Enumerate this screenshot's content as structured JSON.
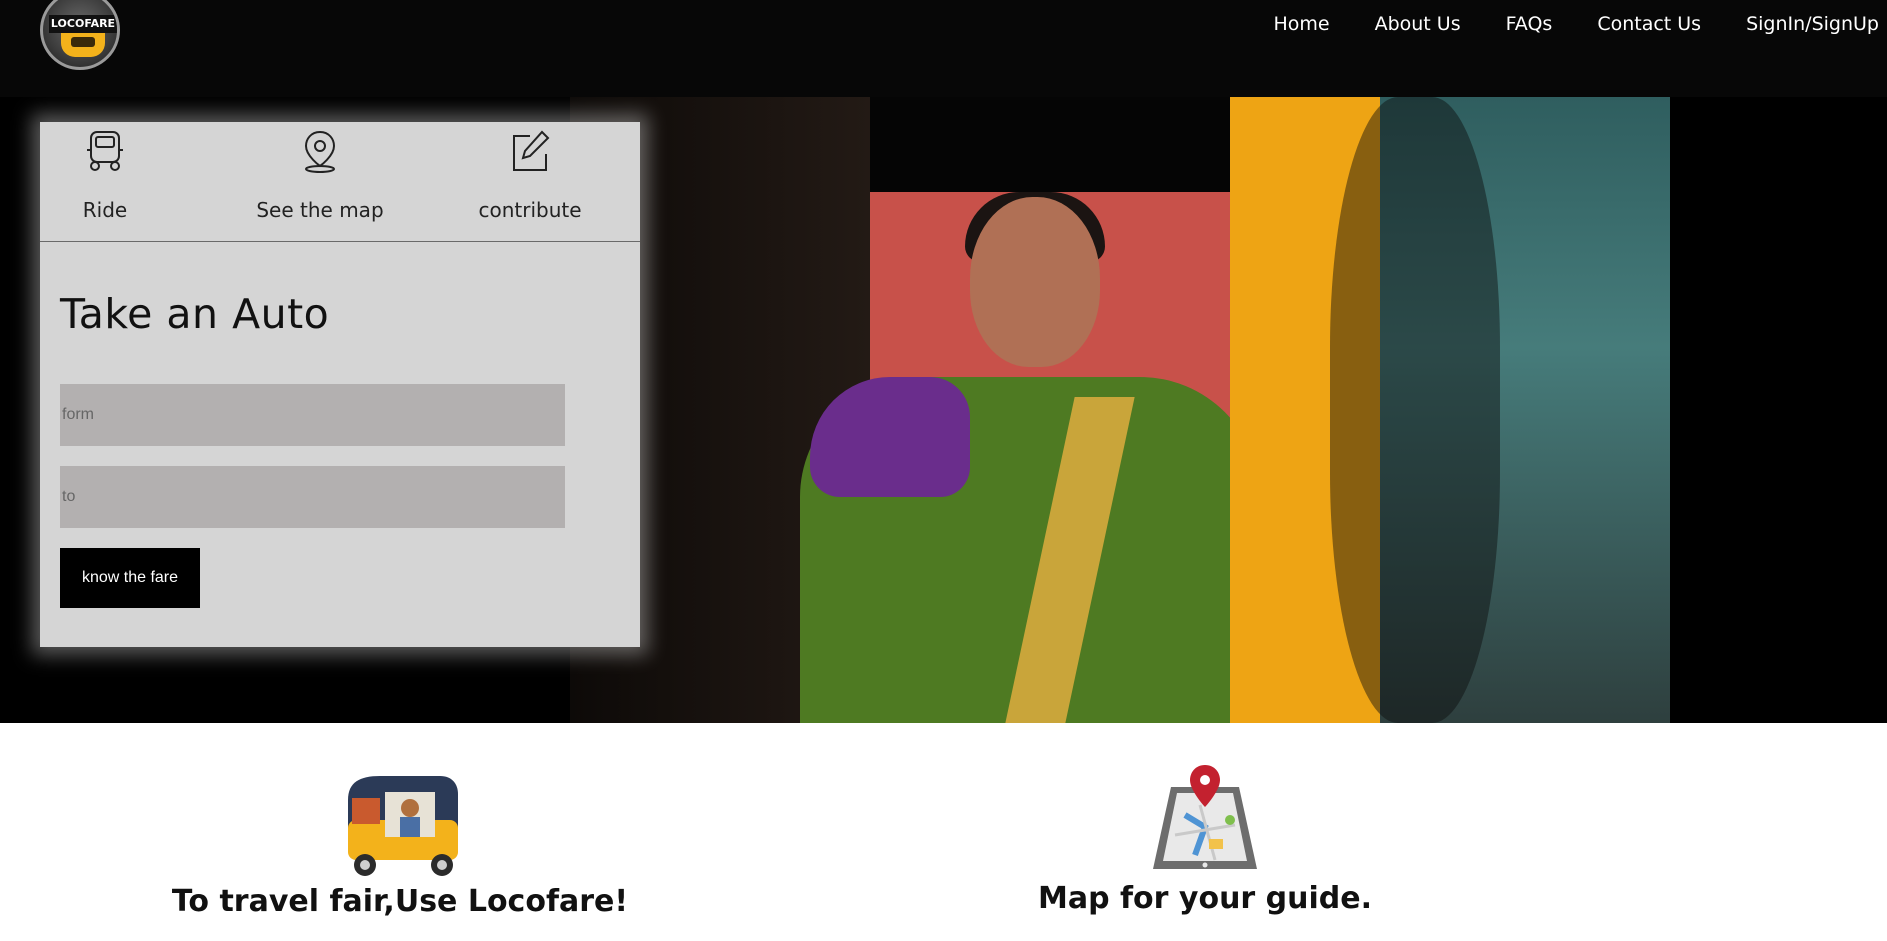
{
  "nav": {
    "logo_text": "LOCOFARE",
    "links": [
      "Home",
      "About Us",
      "FAQs",
      "Contact Us",
      "SignIn/SignUp"
    ]
  },
  "card": {
    "tabs": [
      {
        "label": "Ride",
        "icon": "auto-rickshaw-icon"
      },
      {
        "label": "See the map",
        "icon": "map-pin-icon"
      },
      {
        "label": "contribute",
        "icon": "edit-icon"
      }
    ],
    "title": "Take an Auto",
    "from_placeholder": "form",
    "to_placeholder": "to",
    "button_label": "know the fare"
  },
  "features": [
    {
      "title": "To travel fair,Use Locofare!",
      "icon": "auto-rickshaw-driver-illustration"
    },
    {
      "title": "Map for your guide.",
      "icon": "map-tablet-illustration"
    }
  ],
  "colors": {
    "navbar": "#070707",
    "card": "#d5d5d5",
    "field": "#b3b0b0",
    "button": "#000000",
    "auto_yellow": "#f3b21b"
  }
}
